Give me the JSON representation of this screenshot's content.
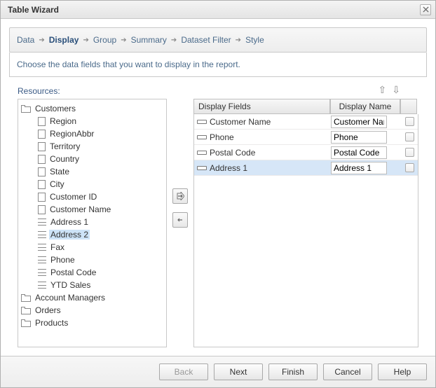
{
  "title": "Table Wizard",
  "breadcrumb": {
    "steps": [
      "Data",
      "Display",
      "Group",
      "Summary",
      "Dataset Filter",
      "Style"
    ],
    "active_index": 1
  },
  "description": "Choose the data fields that you want to display in the report.",
  "resources_label": "Resources:",
  "tree": {
    "root": {
      "label": "Customers",
      "expanded": true,
      "children_pages": [
        "Region",
        "RegionAbbr",
        "Territory",
        "Country",
        "State",
        "City",
        "Customer ID",
        "Customer Name"
      ],
      "children_lines": [
        "Address 1",
        "Address 2",
        "Fax",
        "Phone",
        "Postal Code",
        "YTD Sales"
      ],
      "other_folders": [
        "Account Managers",
        "Orders",
        "Products"
      ],
      "selected_child": "Address 2"
    }
  },
  "grid": {
    "headers": {
      "fields": "Display Fields",
      "name": "Display Name"
    },
    "rows": [
      {
        "field": "Customer Name",
        "name": "Customer Name",
        "selected": false
      },
      {
        "field": "Phone",
        "name": "Phone",
        "selected": false
      },
      {
        "field": "Postal Code",
        "name": "Postal Code",
        "selected": false
      },
      {
        "field": "Address 1",
        "name": "Address 1",
        "selected": true
      }
    ]
  },
  "buttons": {
    "back": "Back",
    "next": "Next",
    "finish": "Finish",
    "cancel": "Cancel",
    "help": "Help"
  }
}
